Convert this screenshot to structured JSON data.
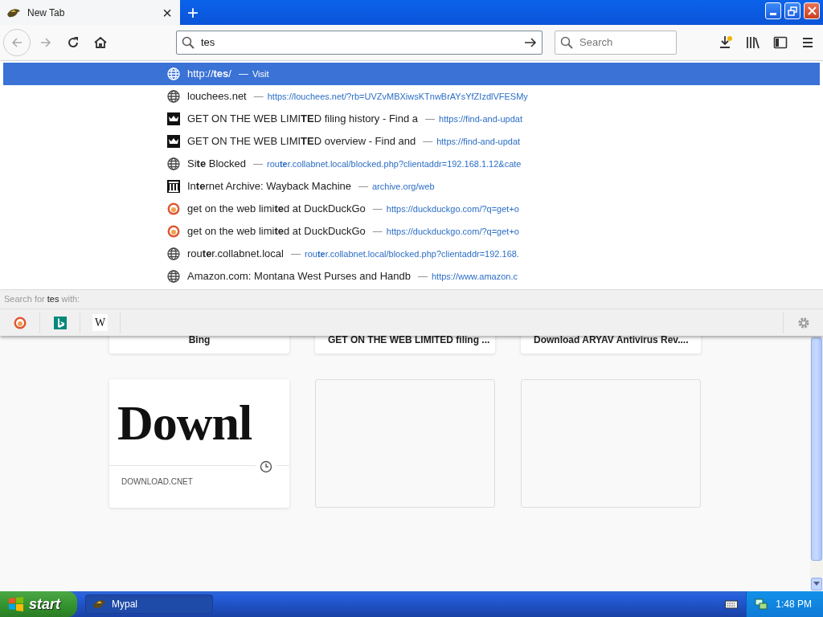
{
  "tab": {
    "title": "New Tab",
    "close": "×"
  },
  "new_tab_button": "+",
  "url_bar": {
    "value": "tes"
  },
  "search_bar": {
    "placeholder": "Search"
  },
  "suggestions": [
    {
      "kind": "page",
      "title": "http://**tes**/",
      "dash": "—",
      "url": "Visit",
      "selected": true
    },
    {
      "kind": "page",
      "title": "louchees.net",
      "dash": "—",
      "url": "https://louchees.net/?rb=UVZvMBXiwsKTnwBrAYsYfZIzdlVFESMy",
      "selected": false
    },
    {
      "kind": "government",
      "title": "GET ON THE WEB LIMI**TE**D filing history - Find a",
      "dash": "—",
      "url": "https://find-and-updat",
      "selected": false
    },
    {
      "kind": "government",
      "title": "GET ON THE WEB LIMI**TE**D overview - Find and",
      "dash": "—",
      "url": "https://find-and-updat",
      "selected": false
    },
    {
      "kind": "page",
      "title": "Si**te** Blocked",
      "dash": "—",
      "url": "rou**te**r.collabnet.local/blocked.php?clientaddr=192.168.1.12&cate",
      "selected": false
    },
    {
      "kind": "archive",
      "title": "In**te**rnet Archive: Wayback Machine",
      "dash": "—",
      "url": "archive.org/web",
      "selected": false
    },
    {
      "kind": "search",
      "title": "get on the web limi**te**d at DuckDuckGo",
      "dash": "—",
      "url": "https://duckduckgo.com/?q=get+o",
      "selected": false
    },
    {
      "kind": "search",
      "title": "get on the web limi**te**d at DuckDuckGo",
      "dash": "—",
      "url": "https://duckduckgo.com/?q=get+o",
      "selected": false
    },
    {
      "kind": "page",
      "title": "rou**te**r.collabnet.local",
      "dash": "—",
      "url": "rou**te**r.collabnet.local/blocked.php?clientaddr=192.168.",
      "selected": false
    },
    {
      "kind": "page",
      "title": "Amazon.com: Montana West Purses and Handb",
      "dash": "—",
      "url": "https://www.amazon.c",
      "selected": false
    }
  ],
  "search_with": {
    "prefix": "Search for ",
    "query": "tes",
    "suffix": " with:"
  },
  "engines": [
    {
      "kind": "duckduckgo"
    },
    {
      "kind": "bing"
    },
    {
      "kind": "wikipedia",
      "label": "W"
    }
  ],
  "top_sites": [
    {
      "title": "Bing"
    },
    {
      "title": "GET ON THE WEB LIMITED filing ..."
    },
    {
      "title": "Download ARYAV Antivirus Rev...."
    }
  ],
  "tiles": [
    {
      "kind": "site",
      "thumbnail_text": "Downl",
      "label": "DOWNLOAD.CNET"
    },
    {
      "kind": "empty"
    },
    {
      "kind": "empty"
    }
  ],
  "taskbar": {
    "start": "start",
    "tasks": [
      {
        "label": "Mypal",
        "selected": true
      }
    ],
    "clock": "1:48 PM"
  }
}
